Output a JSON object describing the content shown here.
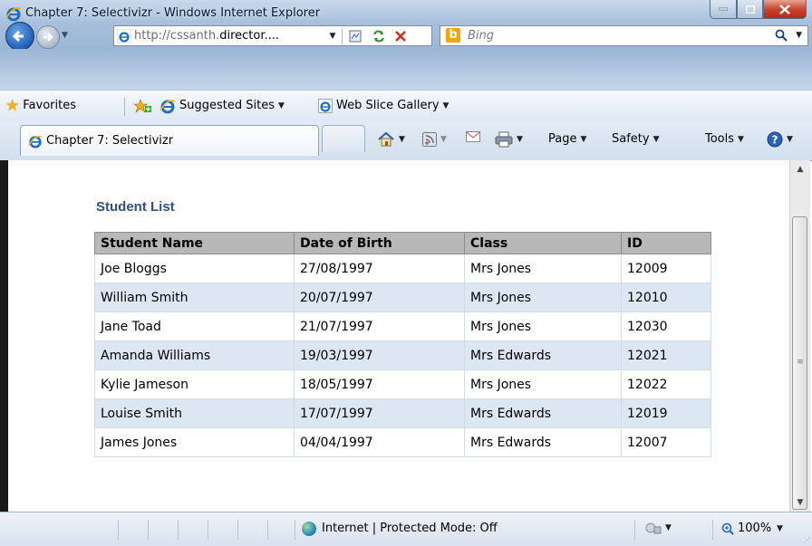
{
  "window": {
    "title": "Chapter 7: Selectivizr - Windows Internet Explorer"
  },
  "address": {
    "url_prefix": "http://cssanth.",
    "url_domain": "director....",
    "search_placeholder": "Bing"
  },
  "favorites": {
    "favorites_label": "Favorites",
    "suggested_label": "Suggested Sites",
    "webslice_label": "Web Slice Gallery"
  },
  "tab": {
    "label": "Chapter 7: Selectivizr"
  },
  "command_bar": {
    "page_label": "Page",
    "safety_label": "Safety",
    "tools_label": "Tools"
  },
  "page": {
    "heading": "Student List",
    "columns": [
      "Student Name",
      "Date of Birth",
      "Class",
      "ID"
    ],
    "rows": [
      [
        "Joe Bloggs",
        "27/08/1997",
        "Mrs Jones",
        "12009"
      ],
      [
        "William Smith",
        "20/07/1997",
        "Mrs Jones",
        "12010"
      ],
      [
        "Jane Toad",
        "21/07/1997",
        "Mrs Jones",
        "12030"
      ],
      [
        "Amanda Williams",
        "19/03/1997",
        "Mrs Edwards",
        "12021"
      ],
      [
        "Kylie Jameson",
        "18/05/1997",
        "Mrs Jones",
        "12022"
      ],
      [
        "Louise Smith",
        "17/07/1997",
        "Mrs Edwards",
        "12019"
      ],
      [
        "James Jones",
        "04/04/1997",
        "Mrs Edwards",
        "12007"
      ]
    ]
  },
  "status_bar": {
    "zone_text": "Internet | Protected Mode: Off",
    "zoom_text": "100%"
  },
  "colors": {
    "heading": "#2f4f85",
    "header_bg": "#b8b8b8",
    "stripe_bg": "#dde6f3"
  }
}
